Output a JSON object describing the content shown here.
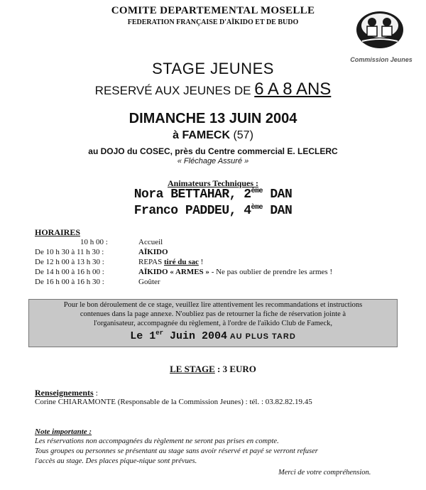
{
  "header": {
    "org": "COMITE DEPARTEMENTAL MOSELLE",
    "federation": "FEDERATION FRANÇAISE D'AÏKIDO ET DE BUDO",
    "logo_caption": "Commission Jeunes"
  },
  "title": {
    "line1": "STAGE JEUNES",
    "line2_prefix": "RESERVÉ AUX JEUNES DE ",
    "line2_highlight": "6 A 8 ANS"
  },
  "event": {
    "date": "DIMANCHE 13 JUIN 2004",
    "city": "à FAMECK",
    "dept": "(57)",
    "venue": "au DOJO du COSEC, près du Centre commercial E. LECLERC",
    "signage": "« Fléchage Assuré »"
  },
  "animators": {
    "heading": "Animateurs Techniques :",
    "person1_name": "Nora BETTAHAR, 2",
    "person1_sup": "ème",
    "person1_rank": " DAN",
    "person2_name": "Franco PADDEU, 4",
    "person2_sup": "ème",
    "person2_rank": " DAN"
  },
  "schedule": {
    "heading": "HORAIRES",
    "rows": [
      {
        "time": "10 h 00 :",
        "activity": "Accueil"
      },
      {
        "time": "De  10 h 30 à 11 h 30 :",
        "activity": "AÏKIDO"
      },
      {
        "time": "De 12 h 00 à 13 h 30 :",
        "activity": "REPAS  ",
        "emph": "tiré du sac",
        "rest": " !"
      },
      {
        "time": "De 14 h 00 à 16 h 00 :",
        "activity": "AÏKIDO « ARMES »",
        "rest": " - Ne pas oublier de prendre les armes !"
      },
      {
        "time": "De 16 h 00 à 16 h 30 :",
        "activity": "Goûter"
      }
    ]
  },
  "notice": {
    "line1": "Pour le bon déroulement de ce stage, veuillez lire attentivement les recommandations et instructions",
    "line2": "contenues dans la page annexe. N'oubliez pas de retourner la fiche de réservation jointe à",
    "line3": "l'organisateur, accompagnée du règlement,  à l'ordre de l'aïkido Club de Fameck,",
    "deadline_prefix": "Le 1",
    "deadline_sup": "er",
    "deadline_main": " Juin 2004",
    "deadline_suffix": " AU PLUS TARD"
  },
  "price": {
    "label": "LE STAGE",
    "value": " : 3 EURO"
  },
  "info": {
    "heading": "Renseignements",
    "colon": " :",
    "contact": "Corine CHIARAMONTE  (Responsable de la Commission Jeunes) : tél. : 03.82.82.19.45"
  },
  "note": {
    "heading": "Note importante :",
    "line1": "Les réservations non accompagnées du règlement ne seront pas prises en compte.",
    "line2": "Tous groupes ou personnes se présentant au stage sans avoir réservé et payé se verront refuser",
    "line3": "l'accès au stage. Des places pique-nique sont prévues.",
    "thanks": "Merci de votre compréhension."
  }
}
